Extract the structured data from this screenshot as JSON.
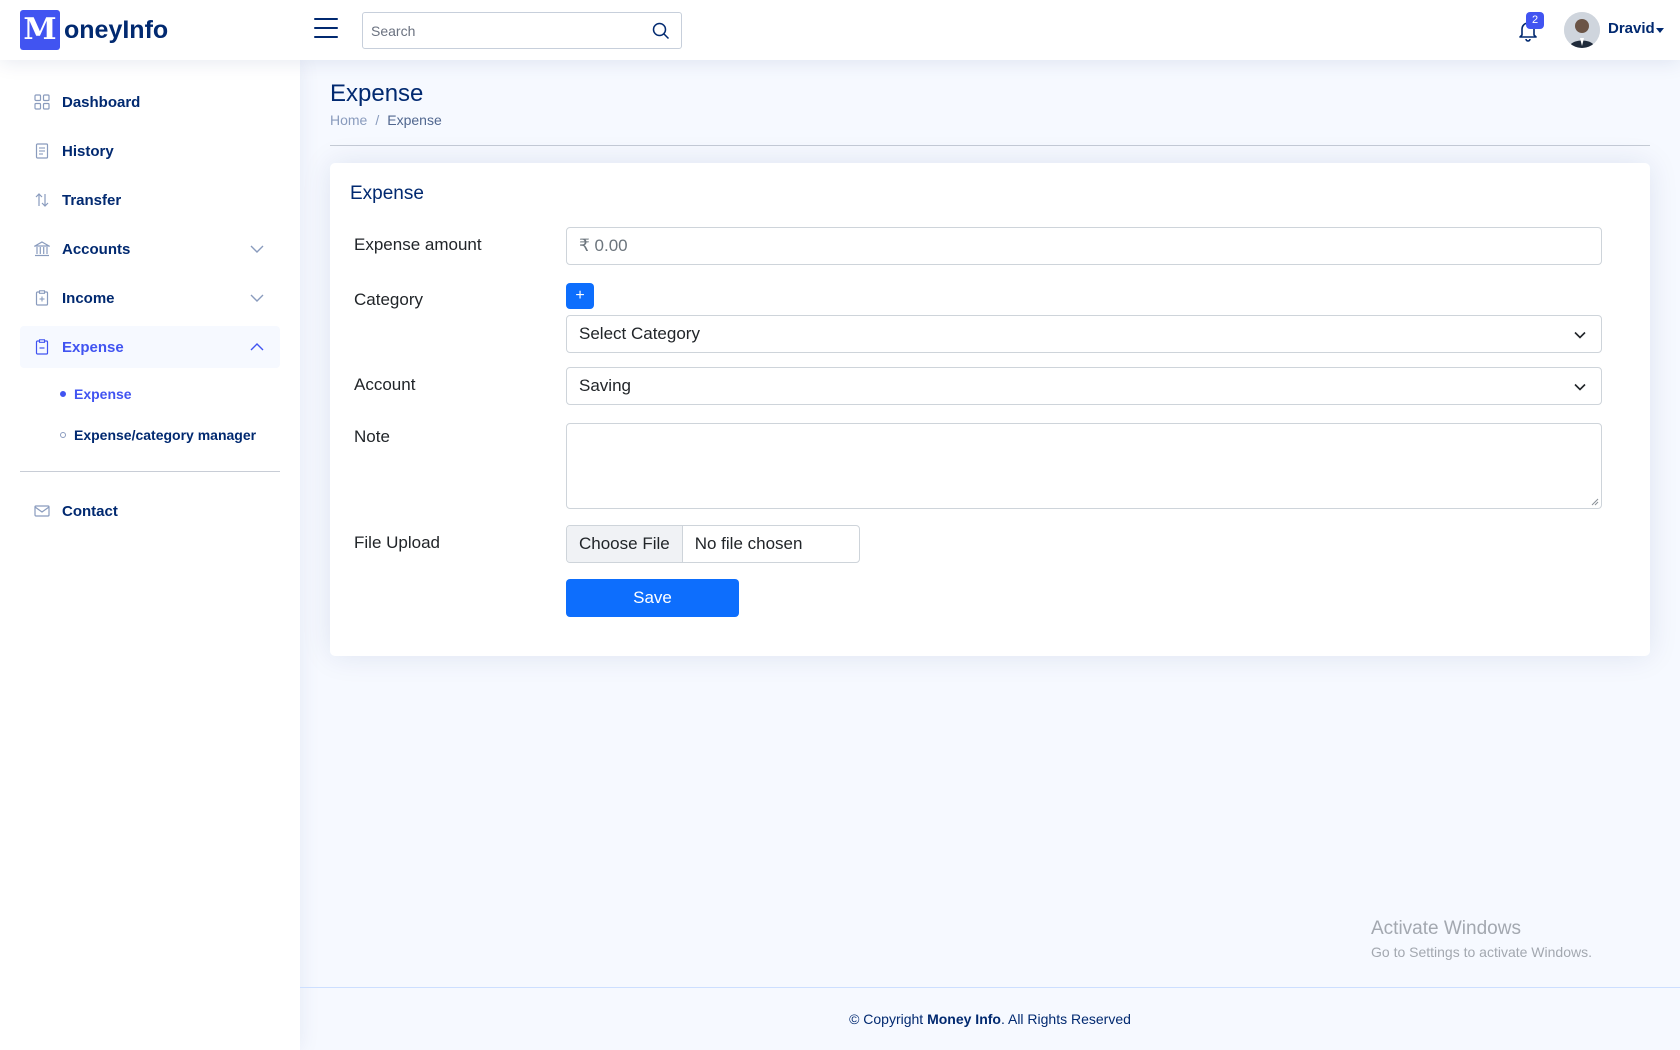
{
  "header": {
    "logo_letter": "M",
    "logo_text": "oneyInfo",
    "search_placeholder": "Search",
    "notification_count": "2",
    "user_name": "Dravid"
  },
  "sidebar": {
    "items": [
      {
        "label": "Dashboard",
        "icon": "grid-icon"
      },
      {
        "label": "History",
        "icon": "journal-icon"
      },
      {
        "label": "Transfer",
        "icon": "arrows-icon"
      },
      {
        "label": "Accounts",
        "icon": "bank-icon"
      },
      {
        "label": "Income",
        "icon": "clipboard-plus-icon"
      },
      {
        "label": "Expense",
        "icon": "clipboard-minus-icon"
      },
      {
        "label": "Contact",
        "icon": "envelope-icon"
      }
    ],
    "expense_sub": [
      {
        "label": "Expense"
      },
      {
        "label": "Expense/category manager"
      }
    ]
  },
  "page": {
    "title": "Expense",
    "breadcrumb_home": "Home",
    "breadcrumb_sep": "/",
    "breadcrumb_current": "Expense"
  },
  "form": {
    "card_title": "Expense",
    "amount_label": "Expense amount",
    "amount_placeholder": "₹ 0.00",
    "category_label": "Category",
    "category_add": "+",
    "category_value": "Select Category",
    "account_label": "Account",
    "account_value": "Saving",
    "note_label": "Note",
    "file_label": "File Upload",
    "file_button": "Choose File",
    "file_status": "No file chosen",
    "save_label": "Save"
  },
  "watermark": {
    "line1": "Activate Windows",
    "line2": "Go to Settings to activate Windows."
  },
  "footer": {
    "prefix": "© Copyright ",
    "brand": "Money Info",
    "suffix": ". All Rights Reserved"
  },
  "colors": {
    "accent": "#4154f1",
    "primary_button": "#0d6efd",
    "text_dark": "#012970"
  }
}
